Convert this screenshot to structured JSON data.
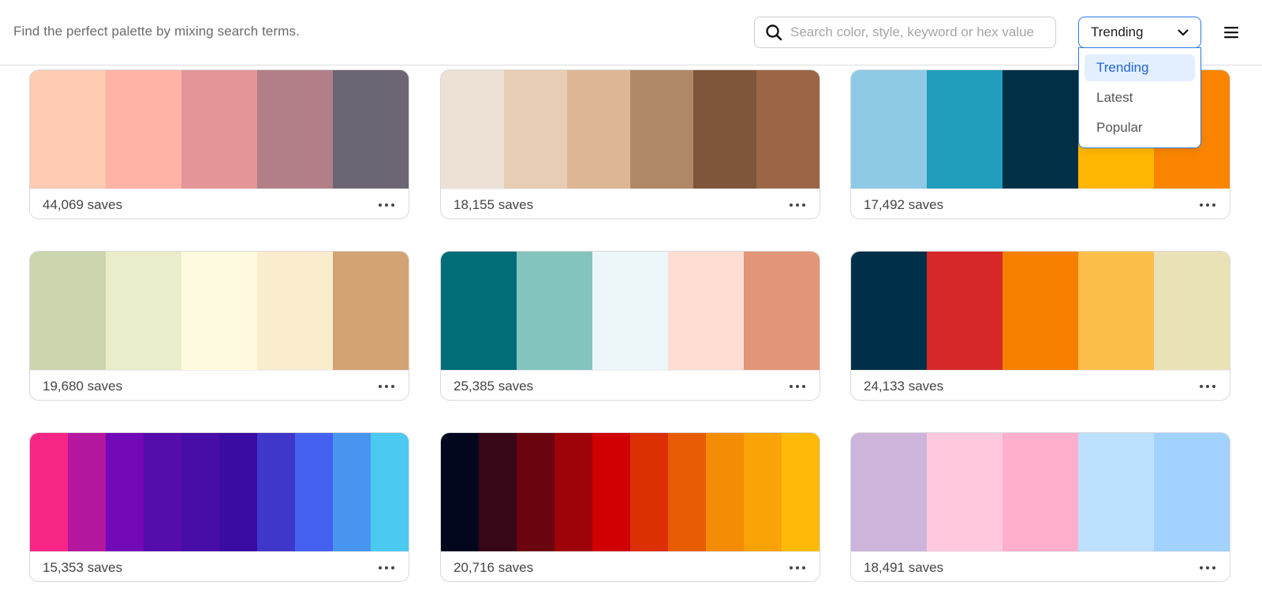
{
  "header": {
    "tagline": "Find the perfect palette by mixing search terms.",
    "search": {
      "placeholder": "Search color, style, keyword or hex value",
      "value": "",
      "icon": "search-icon"
    },
    "sort": {
      "selected": "Trending",
      "options": [
        "Trending",
        "Latest",
        "Popular"
      ]
    },
    "menu_icon": "hamburger-icon"
  },
  "palettes": [
    {
      "saves": "44,069 saves",
      "colors": [
        "#fecbb3",
        "#feb3a6",
        "#e39597",
        "#b27f88",
        "#6b6574"
      ]
    },
    {
      "saves": "18,155 saves",
      "colors": [
        "#ede1d6",
        "#e6cdb4",
        "#ddb794",
        "#af8868",
        "#80553b",
        "#9c6646"
      ]
    },
    {
      "saves": "17,492 saves",
      "colors": [
        "#8ecae6",
        "#219ebc",
        "#023047",
        "#ffb703",
        "#fb8500"
      ]
    },
    {
      "saves": "19,680 saves",
      "colors": [
        "#ccd5ae",
        "#e9edc9",
        "#fefae0",
        "#faedcd",
        "#d4a373"
      ]
    },
    {
      "saves": "25,385 saves",
      "colors": [
        "#006d77",
        "#83c5be",
        "#edf6f9",
        "#ffddd2",
        "#e29578"
      ]
    },
    {
      "saves": "24,133 saves",
      "colors": [
        "#003049",
        "#d62828",
        "#f77f00",
        "#fcbf49",
        "#eae2b7"
      ]
    },
    {
      "saves": "15,353 saves",
      "colors": [
        "#f72585",
        "#b5179e",
        "#7209b7",
        "#560bad",
        "#480ca8",
        "#3a0ca3",
        "#3f37c9",
        "#4361ee",
        "#4895ef",
        "#4cc9f0"
      ]
    },
    {
      "saves": "20,716 saves",
      "colors": [
        "#03071e",
        "#370617",
        "#6a040f",
        "#9d0208",
        "#d00000",
        "#dc2f02",
        "#e85d04",
        "#f48c06",
        "#faa307",
        "#ffba08"
      ]
    },
    {
      "saves": "18,491 saves",
      "colors": [
        "#cdb4db",
        "#ffc8dd",
        "#ffafcc",
        "#bde0fe",
        "#a2d2ff"
      ]
    }
  ]
}
